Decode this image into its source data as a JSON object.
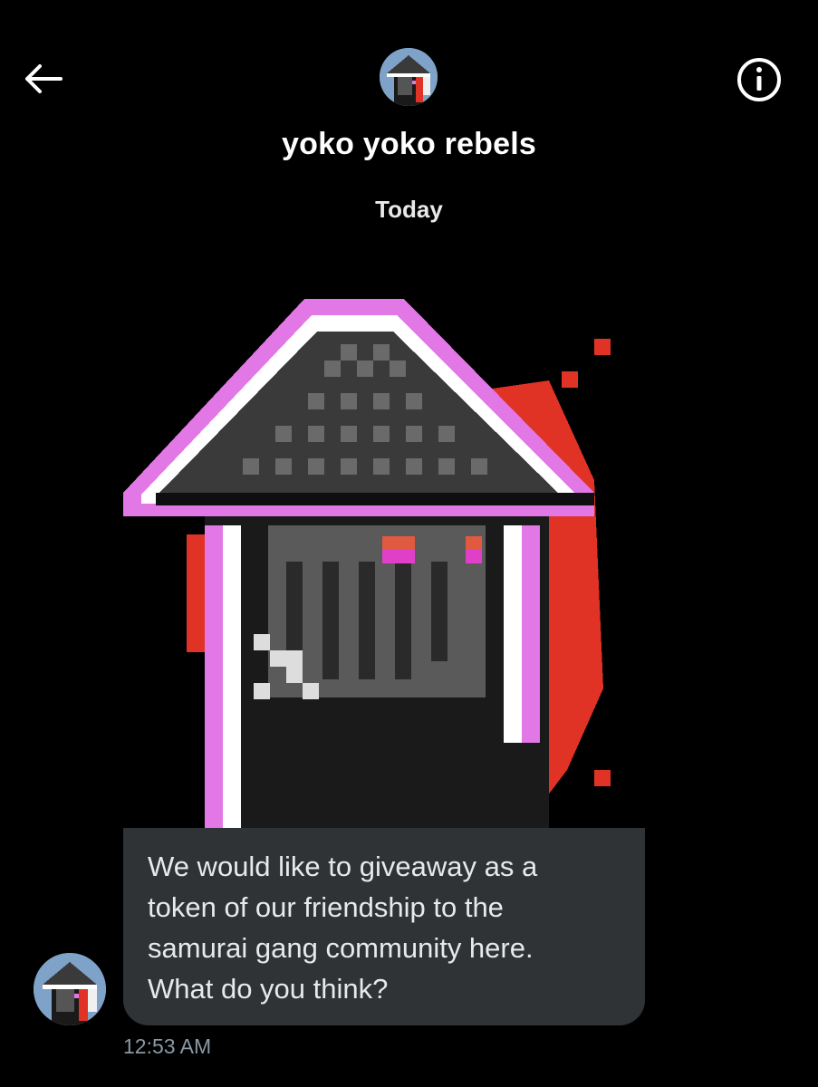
{
  "header": {
    "title": "yoko yoko rebels",
    "back_icon": "arrow-left-icon",
    "info_icon": "info-circle-icon",
    "avatar_icon": "pixel-samurai-avatar"
  },
  "conversation": {
    "date_separator": "Today",
    "message": {
      "media_icon": "pixel-samurai-image",
      "lines": [
        "We would like to giveaway as a",
        "token of our friendship to the",
        "samurai gang community here.",
        "What do you think?"
      ],
      "timestamp": "12:53 AM"
    }
  },
  "colors": {
    "background": "#000000",
    "bubble": "#2f3336",
    "timestamp": "#8b98a5",
    "accent_pink": "#e277e6",
    "accent_red": "#e03325"
  }
}
